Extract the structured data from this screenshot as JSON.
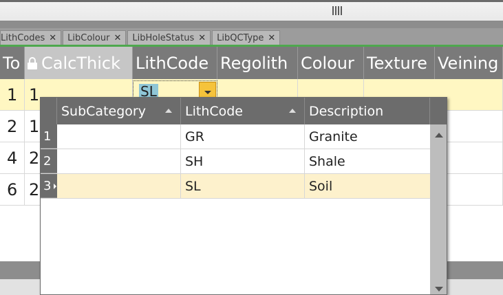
{
  "tabs": [
    {
      "label": "LithCodes",
      "close": "✕"
    },
    {
      "label": "LibColour",
      "close": "✕"
    },
    {
      "label": "LibHoleStatus",
      "close": "✕"
    },
    {
      "label": "LibQCType",
      "close": "✕"
    }
  ],
  "grid": {
    "columns": [
      "To",
      "CalcThick",
      "LithCode",
      "Regolith",
      "Colour",
      "Texture",
      "Veining"
    ],
    "rows": [
      {
        "to": "1",
        "calc": "1"
      },
      {
        "to": "2",
        "calc": "1"
      },
      {
        "to": "4",
        "calc": "2"
      },
      {
        "to": "6",
        "calc": "2"
      }
    ],
    "editor_value": "SL"
  },
  "dropdown": {
    "columns": [
      "SubCategory",
      "LithCode",
      "Description"
    ],
    "rows": [
      {
        "index": "1",
        "sub": "",
        "code": "GR",
        "desc": "Granite"
      },
      {
        "index": "2",
        "sub": "",
        "code": "SH",
        "desc": "Shale"
      },
      {
        "index": "3",
        "sub": "",
        "code": "SL",
        "desc": "Soil"
      }
    ]
  },
  "colors": {
    "accent": "#4ea84e",
    "highlight_row": "#fff7c2",
    "dropdown_button": "#f5c33b"
  }
}
